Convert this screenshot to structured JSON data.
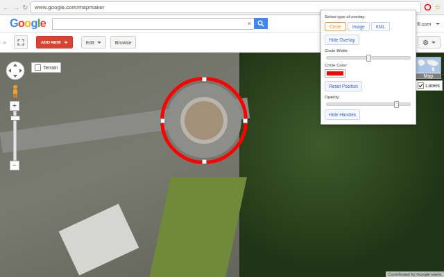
{
  "browser": {
    "nav": [
      "←",
      "→",
      "↻"
    ],
    "url": "www.google.com/mapmaker",
    "star": "☆"
  },
  "header": {
    "logo": "Google",
    "search": {
      "value": "",
      "clear": "×"
    },
    "account": "ill.com"
  },
  "toolbar": {
    "expand": ">",
    "add_new": "ADD NEW",
    "edit": "Edit",
    "browse": "Browse",
    "settings": "⚙"
  },
  "map": {
    "controls": {
      "zoom_in": "+",
      "zoom_out": "−",
      "terrain": {
        "label": "Terrain",
        "checked": false
      }
    },
    "map_type": {
      "label": "Map"
    },
    "labels": {
      "label": "Labels",
      "checked": true
    },
    "overlay": {
      "shape": "circle",
      "handles_visible": true
    },
    "attribution": "Contributed by Google users"
  },
  "overlay_panel": {
    "prompt": "Select type of overlay:",
    "types": [
      {
        "label": "Circle",
        "selected": true
      },
      {
        "label": "Image",
        "selected": false
      },
      {
        "label": "KML",
        "selected": false
      }
    ],
    "controls": [
      {
        "kind": "button",
        "label": "Hide Overlay"
      },
      {
        "kind": "slider",
        "label": "Circle Width:",
        "level": 0.5
      },
      {
        "kind": "color",
        "label": "Circle Color:",
        "color": "#ff0000"
      },
      {
        "kind": "button",
        "label": "Reset Position"
      },
      {
        "kind": "slider",
        "label": "Opacity:",
        "level": 0.83
      },
      {
        "kind": "button",
        "label": "Hide Handles"
      }
    ]
  }
}
